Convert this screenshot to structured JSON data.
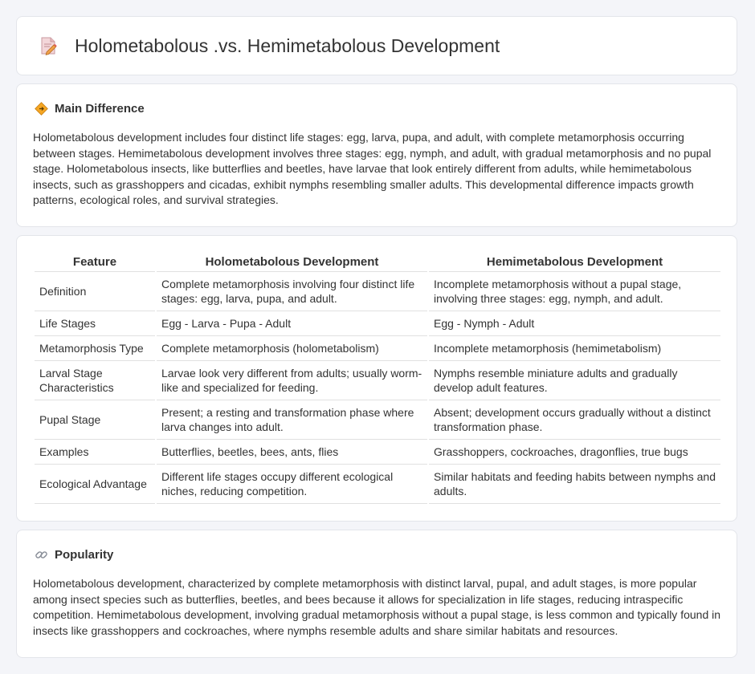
{
  "title": "Holometabolous .vs. Hemimetabolous Development",
  "icons": {
    "title": "document-pencil-icon",
    "main_difference": "diamond-sign-icon",
    "popularity": "link-icon"
  },
  "main_difference": {
    "heading": "Main Difference",
    "text": "Holometabolous development includes four distinct life stages: egg, larva, pupa, and adult, with complete metamorphosis occurring between stages. Hemimetabolous development involves three stages: egg, nymph, and adult, with gradual metamorphosis and no pupal stage. Holometabolous insects, like butterflies and beetles, have larvae that look entirely different from adults, while hemimetabolous insects, such as grasshoppers and cicadas, exhibit nymphs resembling smaller adults. This developmental difference impacts growth patterns, ecological roles, and survival strategies."
  },
  "table": {
    "headers": [
      "Feature",
      "Holometabolous Development",
      "Hemimetabolous Development"
    ],
    "rows": [
      [
        "Definition",
        "Complete metamorphosis involving four distinct life stages: egg, larva, pupa, and adult.",
        "Incomplete metamorphosis without a pupal stage, involving three stages: egg, nymph, and adult."
      ],
      [
        "Life Stages",
        "Egg - Larva - Pupa - Adult",
        "Egg - Nymph - Adult"
      ],
      [
        "Metamorphosis Type",
        "Complete metamorphosis (holometabolism)",
        "Incomplete metamorphosis (hemimetabolism)"
      ],
      [
        "Larval Stage Characteristics",
        "Larvae look very different from adults; usually worm-like and specialized for feeding.",
        "Nymphs resemble miniature adults and gradually develop adult features."
      ],
      [
        "Pupal Stage",
        "Present; a resting and transformation phase where larva changes into adult.",
        "Absent; development occurs gradually without a distinct transformation phase."
      ],
      [
        "Examples",
        "Butterflies, beetles, bees, ants, flies",
        "Grasshoppers, cockroaches, dragonflies, true bugs"
      ],
      [
        "Ecological Advantage",
        "Different life stages occupy different ecological niches, reducing competition.",
        "Similar habitats and feeding habits between nymphs and adults."
      ]
    ]
  },
  "popularity": {
    "heading": "Popularity",
    "text": "Holometabolous development, characterized by complete metamorphosis with distinct larval, pupal, and adult stages, is more popular among insect species such as butterflies, beetles, and bees because it allows for specialization in life stages, reducing intraspecific competition. Hemimetabolous development, involving gradual metamorphosis without a pupal stage, is less common and typically found in insects like grasshoppers and cockroaches, where nymphs resemble adults and share similar habitats and resources."
  }
}
